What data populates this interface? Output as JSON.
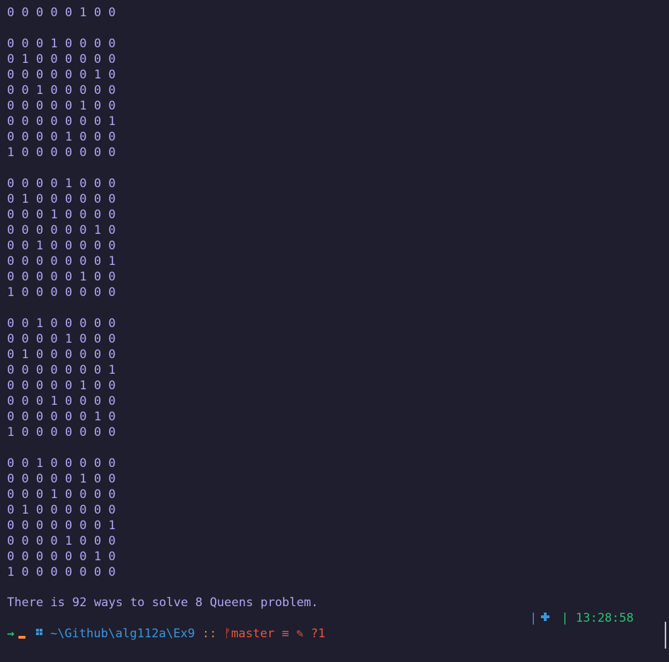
{
  "terminal": {
    "lines": [
      "0 0 0 0 0 1 0 0",
      "",
      "0 0 0 1 0 0 0 0",
      "0 1 0 0 0 0 0 0",
      "0 0 0 0 0 0 1 0",
      "0 0 1 0 0 0 0 0",
      "0 0 0 0 0 1 0 0",
      "0 0 0 0 0 0 0 1",
      "0 0 0 0 1 0 0 0",
      "1 0 0 0 0 0 0 0",
      "",
      "0 0 0 0 1 0 0 0",
      "0 1 0 0 0 0 0 0",
      "0 0 0 1 0 0 0 0",
      "0 0 0 0 0 0 1 0",
      "0 0 1 0 0 0 0 0",
      "0 0 0 0 0 0 0 1",
      "0 0 0 0 0 1 0 0",
      "1 0 0 0 0 0 0 0",
      "",
      "0 0 1 0 0 0 0 0",
      "0 0 0 0 1 0 0 0",
      "0 1 0 0 0 0 0 0",
      "0 0 0 0 0 0 0 1",
      "0 0 0 0 0 1 0 0",
      "0 0 0 1 0 0 0 0",
      "0 0 0 0 0 0 1 0",
      "1 0 0 0 0 0 0 0",
      "",
      "0 0 1 0 0 0 0 0",
      "0 0 0 0 0 1 0 0",
      "0 0 0 1 0 0 0 0",
      "0 1 0 0 0 0 0 0",
      "0 0 0 0 0 0 0 1",
      "0 0 0 0 1 0 0 0",
      "0 0 0 0 0 0 1 0",
      "1 0 0 0 0 0 0 0"
    ],
    "message": "There is 92 ways to solve 8 Queens problem."
  },
  "prompt": {
    "os_icon": "windows-icon",
    "path": "~\\Github\\alg112a\\Ex9",
    "separator": "::",
    "branch_glyph": "ᚠ",
    "branch": "master",
    "status_equal": "≡",
    "status_edit": "✎",
    "status_untracked": "?1",
    "pipe_left": "|",
    "pipe_right": "|",
    "time": "13:28:58",
    "arrow": "→"
  },
  "colors": {
    "background": "#1e1e2e",
    "output_text": "#b4a5f5",
    "path": "#3a96dd",
    "branch": "#e8553e",
    "time": "#2fbf71",
    "cursor": "#ff8a3d"
  }
}
